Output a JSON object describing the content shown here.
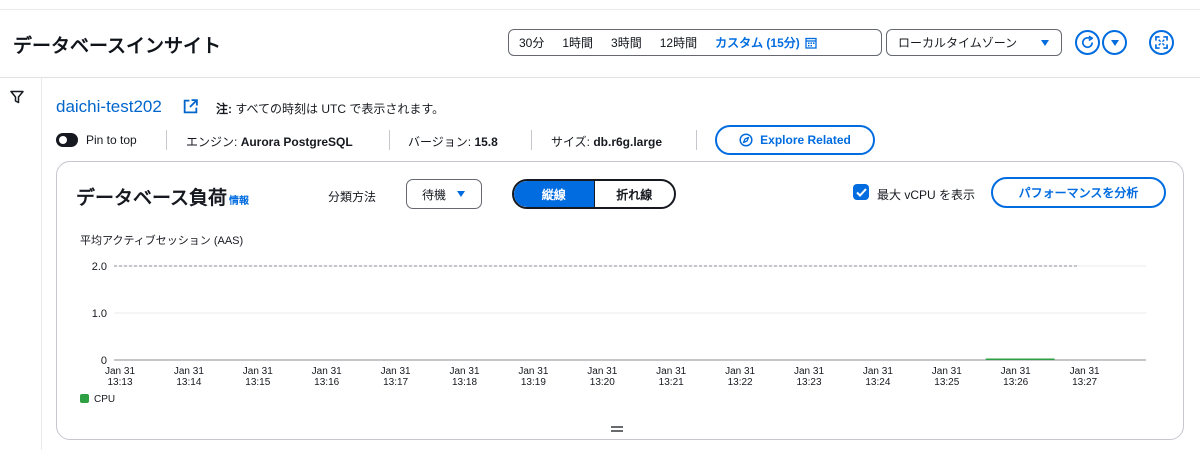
{
  "header": {
    "title": "データベースインサイト",
    "time_ranges": [
      "30分",
      "1時間",
      "3時間",
      "12時間"
    ],
    "custom_range": "カスタム (15分)",
    "timezone": "ローカルタイムゾーン"
  },
  "instance": {
    "name": "daichi-test202",
    "note_label": "注:",
    "note_text": "すべての時刻は UTC で表示されます。"
  },
  "meta": {
    "pin_label": "Pin to top",
    "engine_label": "エンジン:",
    "engine_value": "Aurora PostgreSQL",
    "version_label": "バージョン:",
    "version_value": "15.8",
    "size_label": "サイズ:",
    "size_value": "db.r6g.large",
    "explore_label": "Explore Related"
  },
  "card": {
    "title": "データベース負荷",
    "info": "情報",
    "classify_label": "分類方法",
    "classify_value": "待機",
    "view_options": [
      "縦線",
      "折れ線"
    ],
    "max_vcpu_label": "最大 vCPU を表示",
    "analyze_label": "パフォーマンスを分析"
  },
  "colors": {
    "accent": "#006ce0",
    "cpu": "#2ea043",
    "link": "#0066cc"
  },
  "icons": {
    "external": "external-link-icon",
    "calendar": "calendar-icon",
    "refresh": "refresh-icon",
    "dropdown": "caret-down-icon",
    "fullscreen": "fullscreen-icon",
    "filter": "filter-icon",
    "explore": "compass-icon",
    "check": "check-icon",
    "handle": "drag-handle-icon"
  },
  "chart_data": {
    "type": "bar",
    "ylabel": "平均アクティブセッション (AAS)",
    "ylim": [
      0,
      2.0
    ],
    "yticks": [
      "0",
      "1.0",
      "2.0"
    ],
    "max_vcpu": 2.0,
    "x_dates": [
      "Jan 31",
      "Jan 31",
      "Jan 31",
      "Jan 31",
      "Jan 31",
      "Jan 31",
      "Jan 31",
      "Jan 31",
      "Jan 31",
      "Jan 31",
      "Jan 31",
      "Jan 31",
      "Jan 31",
      "Jan 31",
      "Jan 31"
    ],
    "x_times": [
      "13:13",
      "13:14",
      "13:15",
      "13:16",
      "13:17",
      "13:18",
      "13:19",
      "13:20",
      "13:21",
      "13:22",
      "13:23",
      "13:24",
      "13:25",
      "13:26",
      "13:27"
    ],
    "series": [
      {
        "name": "CPU",
        "color": "#2ea043",
        "points": [
          {
            "start": "13:26",
            "end": "13:27",
            "value": 0.01
          }
        ]
      }
    ],
    "legend": [
      "CPU"
    ],
    "grid": true
  }
}
